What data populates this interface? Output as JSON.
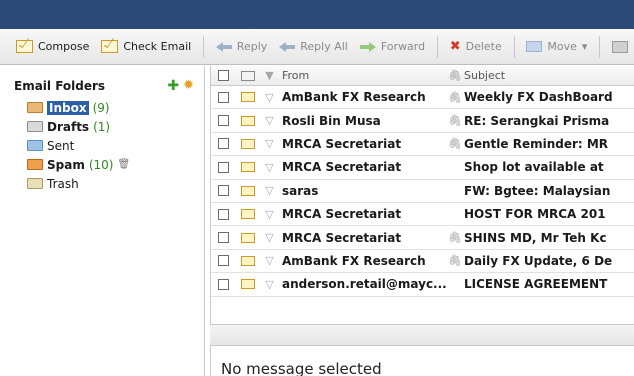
{
  "toolbar": {
    "compose": "Compose",
    "check_email": "Check Email",
    "reply": "Reply",
    "reply_all": "Reply All",
    "forward": "Forward",
    "delete": "Delete",
    "move": "Move"
  },
  "folders": {
    "title": "Email Folders",
    "items": [
      {
        "name": "Inbox",
        "count": "(9)"
      },
      {
        "name": "Drafts",
        "count": "(1)"
      },
      {
        "name": "Sent",
        "count": ""
      },
      {
        "name": "Spam",
        "count": "(10)"
      },
      {
        "name": "Trash",
        "count": ""
      }
    ]
  },
  "list": {
    "columns": {
      "from": "From",
      "subject": "Subject"
    },
    "rows": [
      {
        "from": "AmBank FX Research",
        "subject": "Weekly FX DashBoard"
      },
      {
        "from": "Rosli Bin Musa",
        "subject": "RE: Serangkai Prisma"
      },
      {
        "from": "MRCA Secretariat",
        "subject": "Gentle Reminder: MR"
      },
      {
        "from": "MRCA Secretariat",
        "subject": "Shop lot available at"
      },
      {
        "from": "saras",
        "subject": "FW: Bgtee: Malaysian"
      },
      {
        "from": "MRCA Secretariat",
        "subject": "HOST FOR MRCA 201"
      },
      {
        "from": "MRCA Secretariat",
        "subject": "SHINS MD, Mr Teh Kc"
      },
      {
        "from": "AmBank FX Research",
        "subject": "Daily FX Update, 6 De"
      },
      {
        "from": "anderson.retail@mayc...",
        "subject": "LICENSE AGREEMENT"
      }
    ]
  },
  "preview": {
    "empty_text": "No message selected"
  }
}
